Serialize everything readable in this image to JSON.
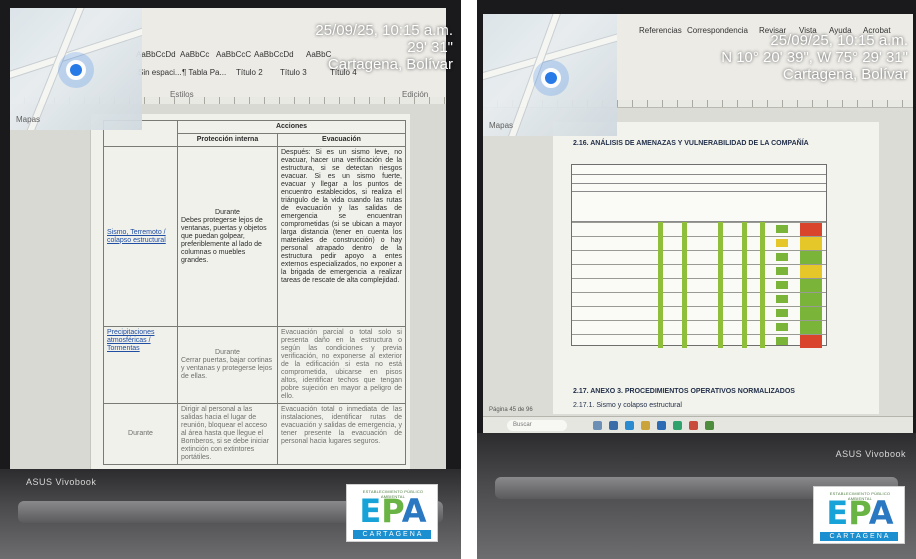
{
  "left_photo": {
    "stamp": {
      "datetime": "25/09/25, 10:15 a.m.",
      "coordinates": "29' 31\"",
      "place": "Cartagena, Bolívar"
    },
    "map_label": "Mapas",
    "ribbon_items": [
      "AaBbCcDd",
      "AaBbCc",
      "AaBbCcC",
      "AaBbCcDd",
      "AaBbC",
      "Sin espaci...",
      "¶ Tabla Pa...",
      "Título 2",
      "Título 3",
      "Título 4"
    ],
    "ribbon_groups": [
      "Estilos",
      "Edición"
    ],
    "table": {
      "header_group": "Acciones",
      "headers": [
        "Protección interna",
        "Evacuación"
      ],
      "rows": [
        {
          "event": "Sismo, Terremoto / colapso estructural",
          "phase": "Durante",
          "protection": "Debes protegerse lejos de ventanas, puertas y objetos que puedan golpear, preferiblemente al lado de columnas o muebles grandes.",
          "evacuation": "Después: Si es un sismo leve, no evacuar, hacer una verificación de la estructura, si se detectan riesgos evacuar. Si es un sismo fuerte, evacuar y llegar a los puntos de encuentro establecidos, si realiza el triángulo de la vida cuando las rutas de evacuación y las salidas de emergencia se encuentran comprometidas (si se ubican a mayor larga distancia (tener en cuenta los materiales de construcción) o hay personal atrapado dentro de la estructura pedir apoyo a entes externos especializados, no exponer a la brigada de emergencia a realizar tareas de rescate de alta complejidad."
        },
        {
          "event": "Precipitaciones atmosféricas / Tormentas",
          "phase": "Durante",
          "protection": "Cerrar puertas, bajar cortinas y ventanas y protegerse lejos de ellas.",
          "evacuation": "Evacuación parcial o total solo si presenta daño en la estructura o según las condiciones y previa verificación, no exponerse al exterior de la edificación si esta no está comprometida, ubicarse en pisos altos, identificar techos que tengan pobre sujeción en mayor a peligro de ello."
        },
        {
          "event": "",
          "phase": "Durante",
          "protection": "Dirigir al personal a las salidas hacia el lugar de reunión, bloquear el acceso al área hasta que llegue el Bomberos, si se debe iniciar extinción con extintores portátiles.",
          "evacuation": "Evacuación total o inmediata de las instalaciones, identificar rutas de evacuación y salidas de emergencia, y tener presente la evacuación de personal hacia lugares seguros."
        }
      ]
    },
    "laptop_brand": "ASUS Vivobook"
  },
  "right_photo": {
    "stamp": {
      "datetime": "25/09/25, 10:15 a.m.",
      "coordinates": "N 10° 20' 39\", W 75° 29' 31\"",
      "place": "Cartagena, Bolívar"
    },
    "map_label": "Mapas",
    "ribbon_tabs": [
      "Referencias",
      "Correspondencia",
      "Revisar",
      "Vista",
      "Ayuda",
      "Acrobat"
    ],
    "section_title": "2.16. ANÁLISIS DE AMENAZAS Y VULNERABILIDAD DE LA COMPAÑÍA",
    "annex_title": "2.17. ANEXO 3. PROCEDIMIENTOS OPERATIVOS NORMALIZADOS",
    "subsection_title": "2.17.1. Sismo y colapso estructural",
    "subsection_note": "Anexo",
    "search_placeholder": "Buscar",
    "status_text": "Página 45 de 96",
    "laptop_brand": "ASUS Vivobook",
    "risk_colors": {
      "high": "#d9452c",
      "medium": "#e6c72a",
      "low": "#7ab539",
      "column_green": "#8fbf3a"
    }
  },
  "logo": {
    "tagline": "ESTABLECIMIENTO PÚBLICO AMBIENTAL",
    "mark": "EPA",
    "city": "CARTAGENA"
  }
}
